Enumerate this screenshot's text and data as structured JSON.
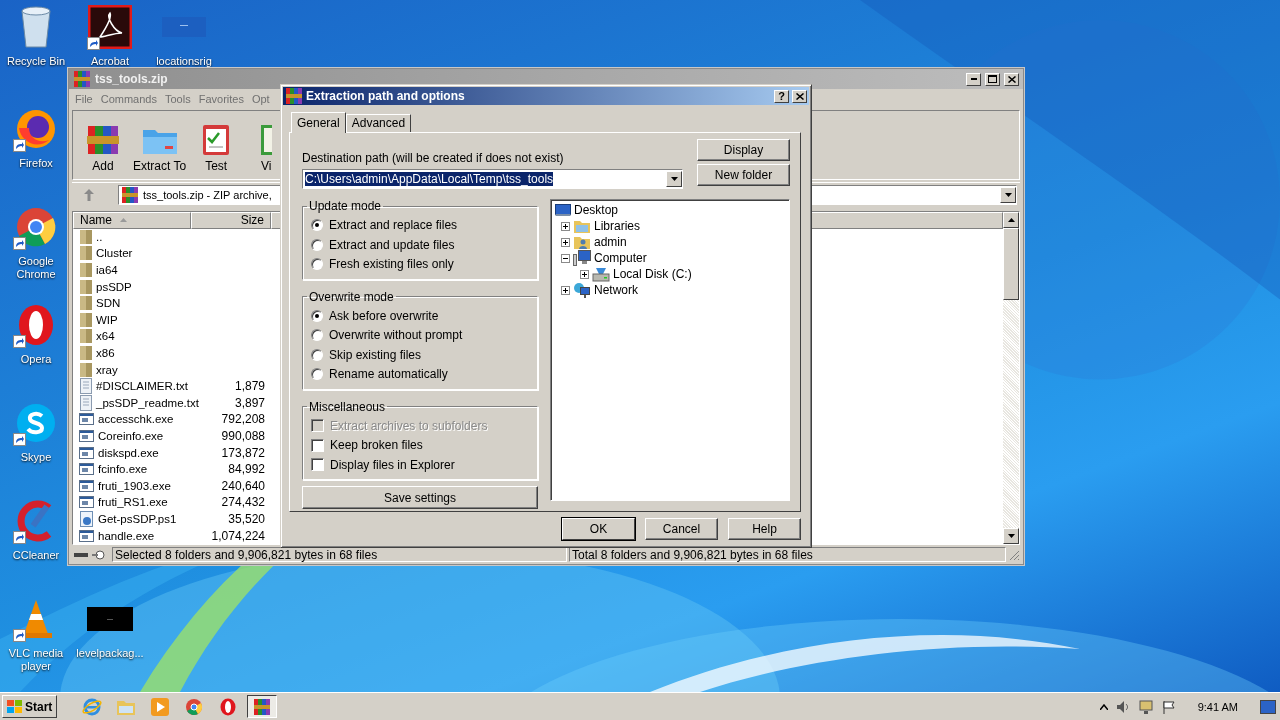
{
  "desktop": {
    "top_row": [
      {
        "label": "Recycle Bin",
        "kind": "recycle",
        "shortcut": false
      },
      {
        "label": "Acrobat",
        "kind": "pdf",
        "shortcut": true
      },
      {
        "label": "locationsrig",
        "kind": "blank",
        "shortcut": false
      }
    ],
    "left_column": [
      {
        "label": "Firefox",
        "kind": "firefox",
        "shortcut": true
      },
      {
        "label": "Google Chrome",
        "kind": "chrome",
        "shortcut": true
      },
      {
        "label": "Opera",
        "kind": "opera",
        "shortcut": true
      },
      {
        "label": "Skype",
        "kind": "skype",
        "shortcut": true
      },
      {
        "label": "CCleaner",
        "kind": "ccleaner",
        "shortcut": true
      }
    ],
    "bottom_row": [
      {
        "label": "VLC media player",
        "kind": "vlc",
        "shortcut": true
      },
      {
        "label": "levelpackag...",
        "kind": "dark",
        "shortcut": false
      }
    ]
  },
  "archive_window": {
    "title": "tss_tools.zip",
    "menu": [
      "File",
      "Commands",
      "Tools",
      "Favorites",
      "Opt"
    ],
    "toolbar": [
      {
        "label": "Add",
        "kind": "add"
      },
      {
        "label": "Extract To",
        "kind": "extract"
      },
      {
        "label": "Test",
        "kind": "test"
      },
      {
        "label": "Vi",
        "kind": "view"
      }
    ],
    "address": "tss_tools.zip - ZIP archive,",
    "columns": [
      "Name",
      "Size"
    ],
    "rows": [
      {
        "name": "..",
        "kind": "folder"
      },
      {
        "name": "Cluster",
        "kind": "folder"
      },
      {
        "name": "ia64",
        "kind": "folder"
      },
      {
        "name": "psSDP",
        "kind": "folder"
      },
      {
        "name": "SDN",
        "kind": "folder"
      },
      {
        "name": "WIP",
        "kind": "folder"
      },
      {
        "name": "x64",
        "kind": "folder"
      },
      {
        "name": "x86",
        "kind": "folder"
      },
      {
        "name": "xray",
        "kind": "folder"
      },
      {
        "name": "#DISCLAIMER.txt",
        "size": "1,879",
        "kind": "text"
      },
      {
        "name": "_psSDP_readme.txt",
        "size": "3,897",
        "kind": "text"
      },
      {
        "name": "accesschk.exe",
        "size": "792,208",
        "kind": "exe"
      },
      {
        "name": "Coreinfo.exe",
        "size": "990,088",
        "kind": "exe"
      },
      {
        "name": "diskspd.exe",
        "size": "173,872",
        "kind": "exe"
      },
      {
        "name": "fcinfo.exe",
        "size": "84,992",
        "kind": "exe"
      },
      {
        "name": "fruti_1903.exe",
        "size": "240,640",
        "kind": "exe"
      },
      {
        "name": "fruti_RS1.exe",
        "size": "274,432",
        "kind": "exe"
      },
      {
        "name": "Get-psSDP.ps1",
        "size": "35,520",
        "kind": "script"
      },
      {
        "name": "handle.exe",
        "size": "1,074,224",
        "kind": "exe"
      }
    ],
    "status_left": "Selected 8 folders and 9,906,821 bytes in 68 files",
    "status_right": "Total 8 folders and 9,906,821 bytes in 68 files"
  },
  "dialog": {
    "title": "Extraction path and options",
    "help_button": "?",
    "tabs": [
      {
        "label": "General",
        "selected": true
      },
      {
        "label": "Advanced",
        "selected": false
      }
    ],
    "path_label": "Destination path (will be created if does not exist)",
    "path": "C:\\Users\\admin\\AppData\\Local\\Temp\\tss_tools",
    "path_highlighted": true,
    "side_buttons": [
      "Display",
      "New folder"
    ],
    "groups": [
      {
        "title": "Update mode",
        "kind": "radio",
        "options": [
          {
            "label": "Extract and replace files",
            "selected": true
          },
          {
            "label": "Extract and update files",
            "selected": false
          },
          {
            "label": "Fresh existing files only",
            "selected": false
          }
        ]
      },
      {
        "title": "Overwrite mode",
        "kind": "radio",
        "options": [
          {
            "label": "Ask before overwrite",
            "selected": true
          },
          {
            "label": "Overwrite without prompt",
            "selected": false
          },
          {
            "label": "Skip existing files",
            "selected": false
          },
          {
            "label": "Rename automatically",
            "selected": false
          }
        ]
      },
      {
        "title": "Miscellaneous",
        "kind": "check",
        "options": [
          {
            "label": "Extract archives to subfolders",
            "checked": false,
            "disabled": true
          },
          {
            "label": "Keep broken files",
            "checked": false,
            "disabled": false
          },
          {
            "label": "Display files in Explorer",
            "checked": false,
            "disabled": false
          }
        ]
      }
    ],
    "save_button": "Save settings",
    "tree": {
      "label": "Desktop",
      "kind": "desktop",
      "children": [
        {
          "label": "Libraries",
          "kind": "libraries",
          "expanded": false
        },
        {
          "label": "admin",
          "kind": "user",
          "expanded": false
        },
        {
          "label": "Computer",
          "kind": "computer",
          "expanded": true,
          "children": [
            {
              "label": "Local Disk (C:)",
              "kind": "drive",
              "expanded": false
            }
          ]
        },
        {
          "label": "Network",
          "kind": "network",
          "expanded": false
        }
      ]
    },
    "buttons": [
      {
        "label": "OK",
        "default": true
      },
      {
        "label": "Cancel",
        "default": false
      },
      {
        "label": "Help",
        "default": false
      }
    ]
  },
  "taskbar": {
    "start": "Start",
    "items": [
      {
        "kind": "ie",
        "selected": false
      },
      {
        "kind": "explorer",
        "selected": false
      },
      {
        "kind": "media",
        "selected": false
      },
      {
        "kind": "chrome",
        "selected": false
      },
      {
        "kind": "opera",
        "selected": false
      },
      {
        "kind": "winrar",
        "selected": true
      }
    ],
    "clock": "9:41 AM"
  }
}
